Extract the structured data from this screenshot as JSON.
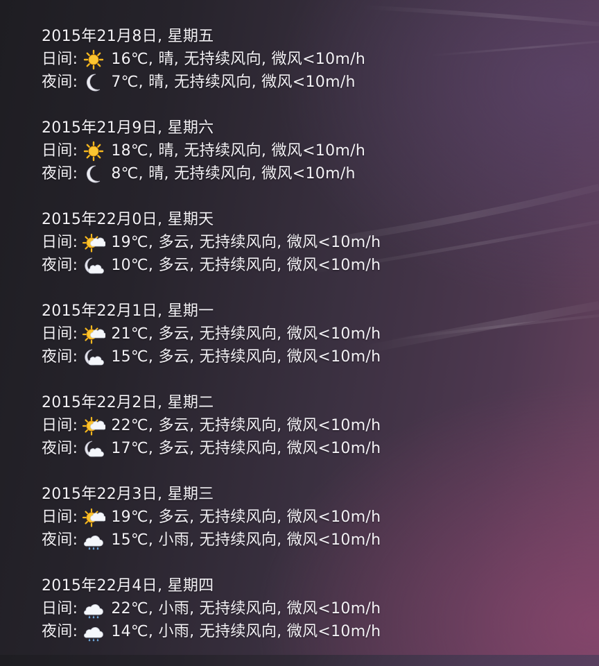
{
  "labels": {
    "day": "日间:",
    "night": "夜间:"
  },
  "days": [
    {
      "date": "2015年21月8日, 星期五",
      "day": {
        "icon": "sun-icon",
        "text": "16℃, 晴, 无持续风向, 微风<10m/h"
      },
      "night": {
        "icon": "moon-icon",
        "text": "7℃, 晴, 无持续风向, 微风<10m/h"
      }
    },
    {
      "date": "2015年21月9日, 星期六",
      "day": {
        "icon": "sun-icon",
        "text": "18℃, 晴, 无持续风向, 微风<10m/h"
      },
      "night": {
        "icon": "moon-icon",
        "text": "8℃, 晴, 无持续风向, 微风<10m/h"
      }
    },
    {
      "date": "2015年22月0日, 星期天",
      "day": {
        "icon": "sun-cloud-icon",
        "text": "19℃, 多云, 无持续风向, 微风<10m/h"
      },
      "night": {
        "icon": "moon-cloud-icon",
        "text": "10℃, 多云, 无持续风向, 微风<10m/h"
      }
    },
    {
      "date": "2015年22月1日, 星期一",
      "day": {
        "icon": "sun-cloud-icon",
        "text": "21℃, 多云, 无持续风向, 微风<10m/h"
      },
      "night": {
        "icon": "moon-cloud-icon",
        "text": "15℃, 多云, 无持续风向, 微风<10m/h"
      }
    },
    {
      "date": "2015年22月2日, 星期二",
      "day": {
        "icon": "sun-cloud-icon",
        "text": "22℃, 多云, 无持续风向, 微风<10m/h"
      },
      "night": {
        "icon": "moon-cloud-icon",
        "text": "17℃, 多云, 无持续风向, 微风<10m/h"
      }
    },
    {
      "date": "2015年22月3日, 星期三",
      "day": {
        "icon": "sun-cloud-icon",
        "text": "19℃, 多云, 无持续风向, 微风<10m/h"
      },
      "night": {
        "icon": "rain-cloud-icon",
        "text": "15℃, 小雨, 无持续风向, 微风<10m/h"
      }
    },
    {
      "date": "2015年22月4日, 星期四",
      "day": {
        "icon": "rain-cloud-icon",
        "text": "22℃, 小雨, 无持续风向, 微风<10m/h"
      },
      "night": {
        "icon": "rain-cloud-icon",
        "text": "14℃, 小雨, 无持续风向, 微风<10m/h"
      }
    }
  ],
  "colors": {
    "text": "#f3f1f5",
    "sun": "#f6b81e",
    "moon": "#e8e8ee",
    "cloud": "#f4f6fa"
  }
}
